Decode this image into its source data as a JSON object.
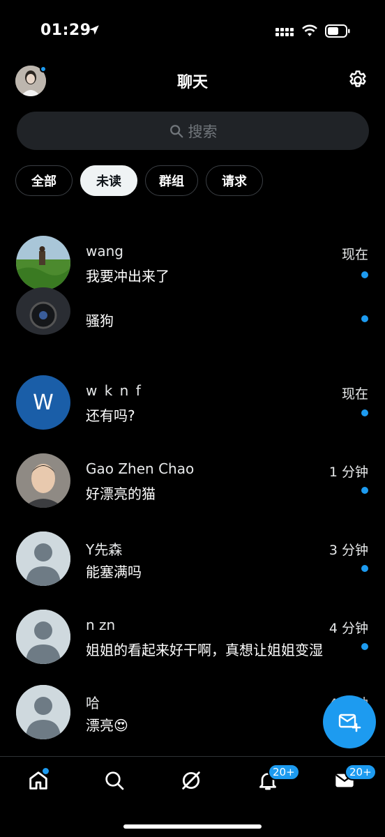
{
  "status_bar": {
    "time": "01:29"
  },
  "header": {
    "title": "聊天"
  },
  "search": {
    "placeholder": "搜索"
  },
  "filters": [
    {
      "label": "全部",
      "active": false
    },
    {
      "label": "未读",
      "active": true
    },
    {
      "label": "群组",
      "active": false
    },
    {
      "label": "请求",
      "active": false
    }
  ],
  "chats": [
    {
      "name": "wang",
      "preview": "我要冲出来了",
      "time": "现在",
      "unread": true,
      "avatar": "photo-grass-field"
    },
    {
      "name": "",
      "preview": "骚狗",
      "time": "",
      "unread": true,
      "avatar": "photo-car-interior"
    },
    {
      "name": "w k n f",
      "preview": "还有吗?",
      "time": "现在",
      "unread": true,
      "avatar": "W"
    },
    {
      "name": "Gao Zhen Chao",
      "preview": "好漂亮的猫",
      "time": "1 分钟",
      "unread": true,
      "avatar": "photo-portrait"
    },
    {
      "name": "Y先森",
      "preview": "能塞满吗",
      "time": "3 分钟",
      "unread": true,
      "avatar": "default-avatar"
    },
    {
      "name": "n zn",
      "preview": "姐姐的看起来好干啊，真想让姐姐变湿",
      "time": "4 分钟",
      "unread": true,
      "avatar": "default-avatar"
    },
    {
      "name": "哈",
      "preview": "漂亮😍",
      "time": "4 分钟",
      "unread": false,
      "avatar": "default-avatar"
    }
  ],
  "nav": {
    "notifications_badge": "20+",
    "messages_badge": "20+"
  },
  "colors": {
    "accent": "#1d9bf0",
    "background": "#000000",
    "search_bg": "#202327",
    "avatar_w_bg": "#1a5ea8"
  }
}
